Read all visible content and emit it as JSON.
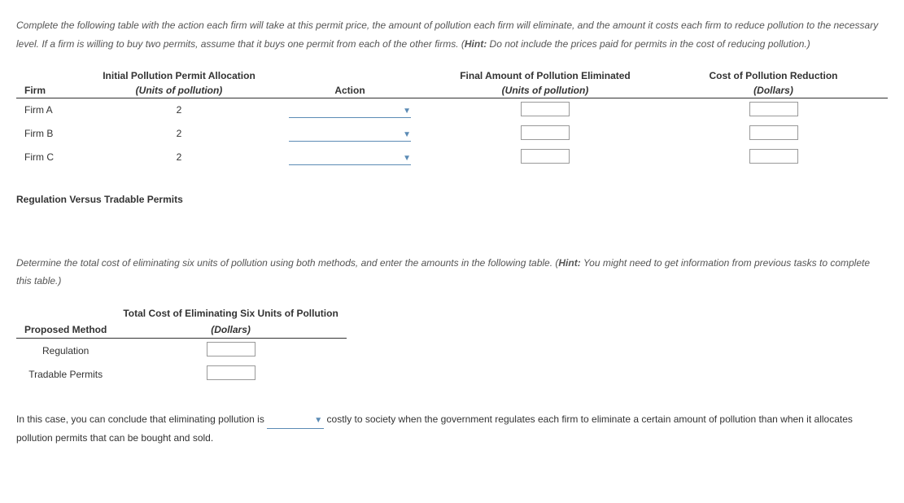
{
  "intro": {
    "text_parts": [
      "Complete the following table with the action each firm will take at this permit price, the amount of pollution each firm will eliminate, and the amount it costs each firm to reduce pollution to the necessary level. If a firm is willing to buy two permits, assume that it buys one permit from each of the other firms. (",
      "Hint:",
      " Do not include the prices paid for permits in the cost of reducing pollution.)"
    ]
  },
  "table1": {
    "headers": {
      "firm": "Firm",
      "allocation_title": "Initial Pollution Permit Allocation",
      "allocation_unit": "(Units of pollution)",
      "action": "Action",
      "eliminated_title": "Final Amount of Pollution Eliminated",
      "eliminated_unit": "(Units of pollution)",
      "cost_title": "Cost of Pollution Reduction",
      "cost_unit": "(Dollars)"
    },
    "rows": [
      {
        "firm": "Firm A",
        "allocation": "2"
      },
      {
        "firm": "Firm B",
        "allocation": "2"
      },
      {
        "firm": "Firm C",
        "allocation": "2"
      }
    ]
  },
  "section_heading": "Regulation Versus Tradable Permits",
  "intro2": {
    "text_parts": [
      "Determine the total cost of eliminating six units of pollution using both methods, and enter the amounts in the following table. (",
      "Hint:",
      " You might need to get information from previous tasks to complete this table.)"
    ]
  },
  "table2": {
    "headers": {
      "method": "Proposed Method",
      "cost_title": "Total Cost of Eliminating Six Units of Pollution",
      "cost_unit": "(Dollars)"
    },
    "rows": [
      {
        "method": "Regulation"
      },
      {
        "method": "Tradable Permits"
      }
    ]
  },
  "conclusion": {
    "before": "In this case, you can conclude that eliminating pollution is ",
    "after": " costly to society when the government regulates each firm to eliminate a certain amount of pollution than when it allocates pollution permits that can be bought and sold."
  }
}
